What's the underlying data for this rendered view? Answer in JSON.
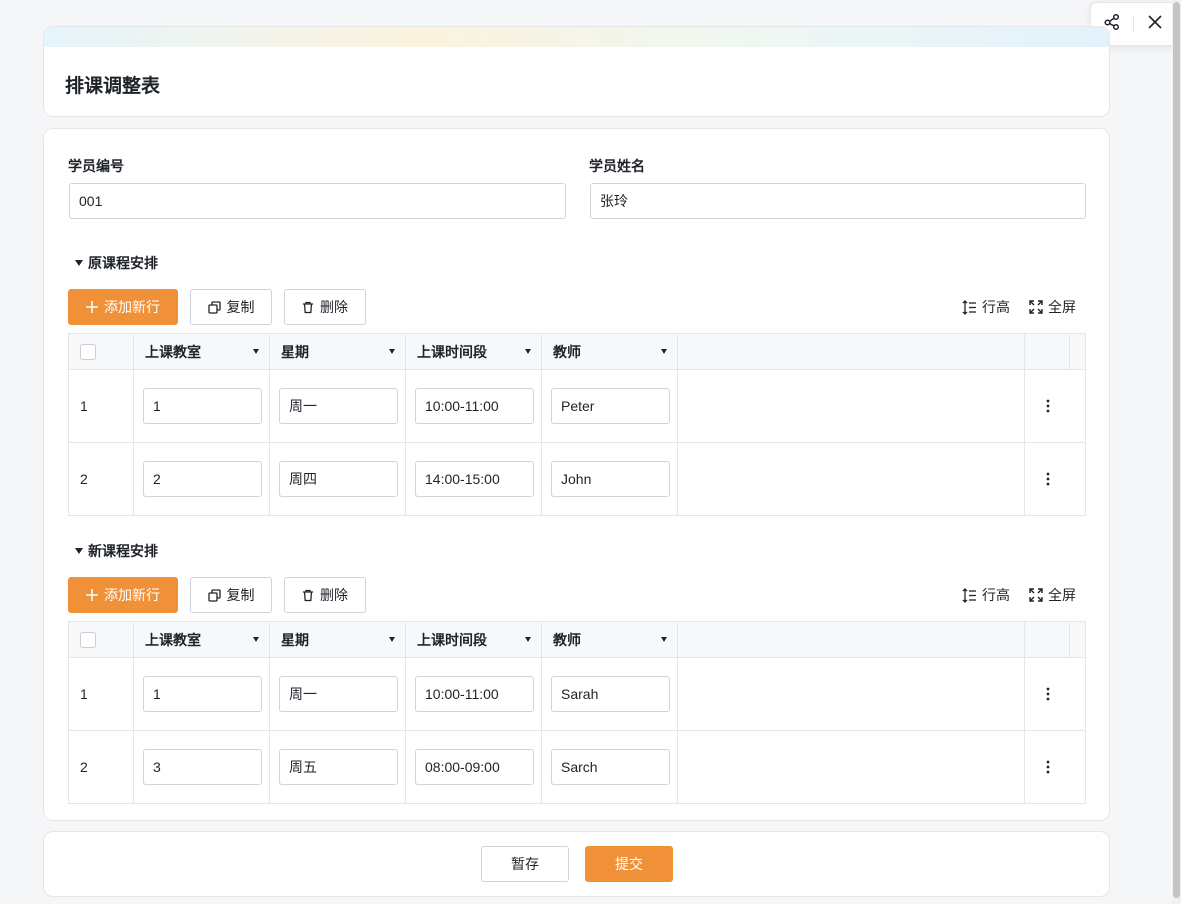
{
  "page": {
    "title": "排课调整表",
    "accent_color": "#f0913a"
  },
  "form": {
    "student_id": {
      "label": "学员编号",
      "value": "001"
    },
    "student_name": {
      "label": "学员姓名",
      "value": "张玲"
    }
  },
  "toolbar": {
    "add_row": "添加新行",
    "copy": "复制",
    "delete": "删除",
    "row_height": "行高",
    "fullscreen": "全屏"
  },
  "columns": [
    "上课教室",
    "星期",
    "上课时间段",
    "教师"
  ],
  "original_schedule": {
    "title": "原课程安排",
    "rows": [
      {
        "index": "1",
        "classroom": "1",
        "weekday": "周一",
        "time": "10:00-11:00",
        "teacher": "Peter"
      },
      {
        "index": "2",
        "classroom": "2",
        "weekday": "周四",
        "time": "14:00-15:00",
        "teacher": "John"
      }
    ]
  },
  "new_schedule": {
    "title": "新课程安排",
    "rows": [
      {
        "index": "1",
        "classroom": "1",
        "weekday": "周一",
        "time": "10:00-11:00",
        "teacher": "Sarah"
      },
      {
        "index": "2",
        "classroom": "3",
        "weekday": "周五",
        "time": "08:00-09:00",
        "teacher": "Sarch"
      }
    ]
  },
  "footer": {
    "save_draft": "暂存",
    "submit": "提交"
  },
  "icons": {
    "share": "share-icon",
    "close": "close-icon",
    "plus": "plus-icon",
    "copy": "copy-icon",
    "trash": "trash-icon",
    "row_height": "row-height-icon",
    "fullscreen": "fullscreen-icon",
    "more": "more-vertical-icon"
  }
}
